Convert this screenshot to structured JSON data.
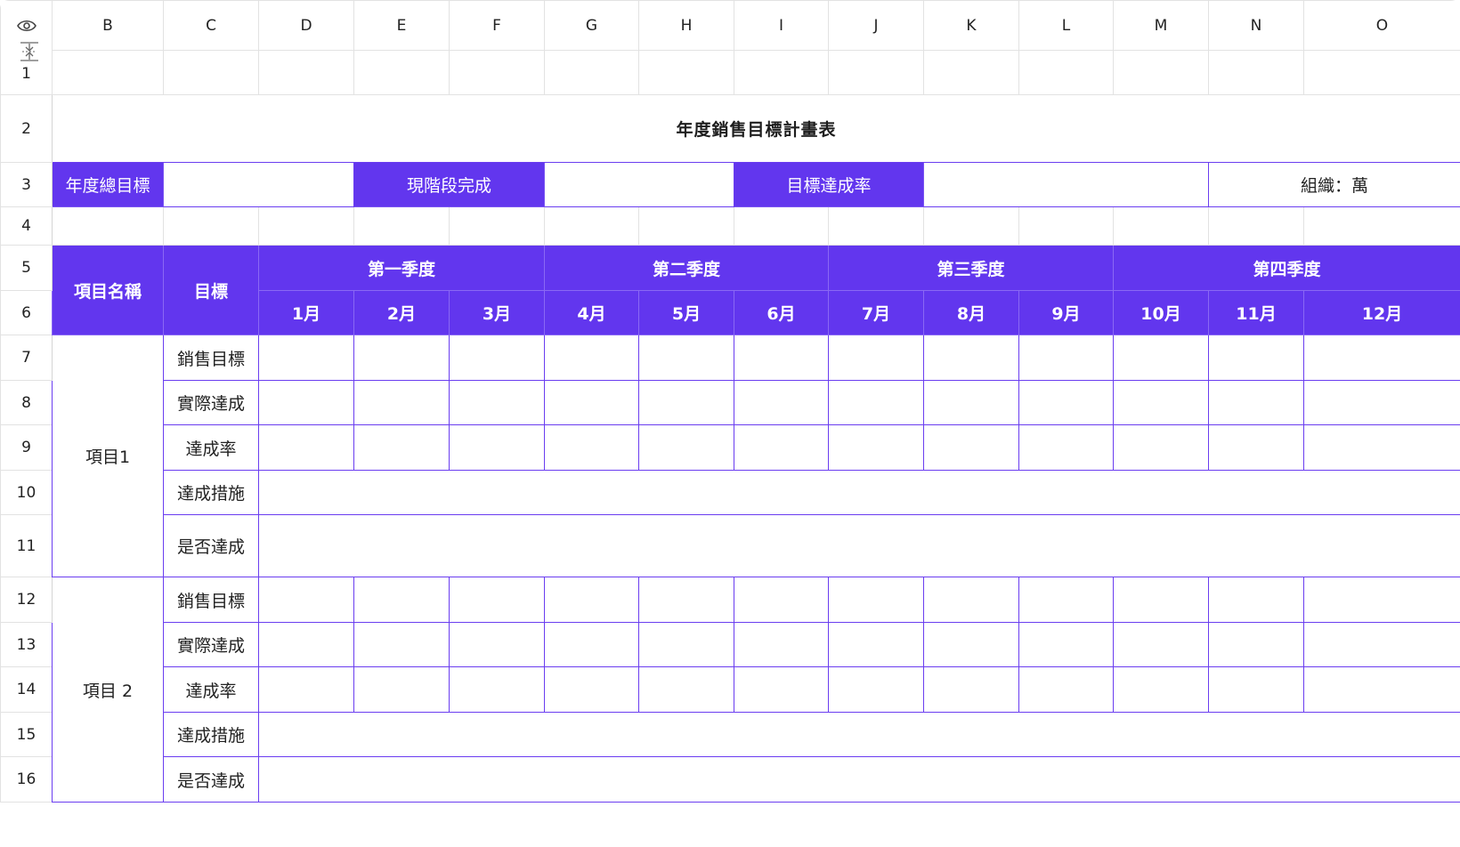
{
  "columns": [
    "B",
    "C",
    "D",
    "E",
    "F",
    "G",
    "H",
    "I",
    "J",
    "K",
    "L",
    "M",
    "N",
    "O"
  ],
  "rows": [
    "1",
    "2",
    "3",
    "4",
    "5",
    "6",
    "7",
    "8",
    "9",
    "10",
    "11",
    "12",
    "13",
    "14",
    "15",
    "16"
  ],
  "title": "年度銷售目標計畫表",
  "summary": {
    "annual_target_label": "年度總目標",
    "annual_target_value": "",
    "stage_done_label": "現階段完成",
    "stage_done_value": "",
    "rate_label": "目標達成率",
    "rate_value": "",
    "org_label": "組織：萬"
  },
  "table_header": {
    "item_name": "項目名稱",
    "target": "目標",
    "quarters": [
      "第一季度",
      "第二季度",
      "第三季度",
      "第四季度"
    ],
    "months": [
      "1月",
      "2月",
      "3月",
      "4月",
      "5月",
      "6月",
      "7月",
      "8月",
      "9月",
      "10月",
      "11月",
      "12月"
    ]
  },
  "projects": [
    {
      "name": "項目1",
      "metrics": [
        "銷售目標",
        "實際達成",
        "達成率",
        "達成措施",
        "是否達成"
      ]
    },
    {
      "name": "項目 2",
      "metrics": [
        "銷售目標",
        "實際達成",
        "達成率",
        "達成措施",
        "是否達成"
      ]
    }
  ],
  "icons": {
    "eye": "eye-icon",
    "fold": "collapse-rows-icon"
  },
  "colors": {
    "accent": "#6236ee",
    "grid_line": "#e2e2e2",
    "accent_line": "#6a3df0"
  }
}
